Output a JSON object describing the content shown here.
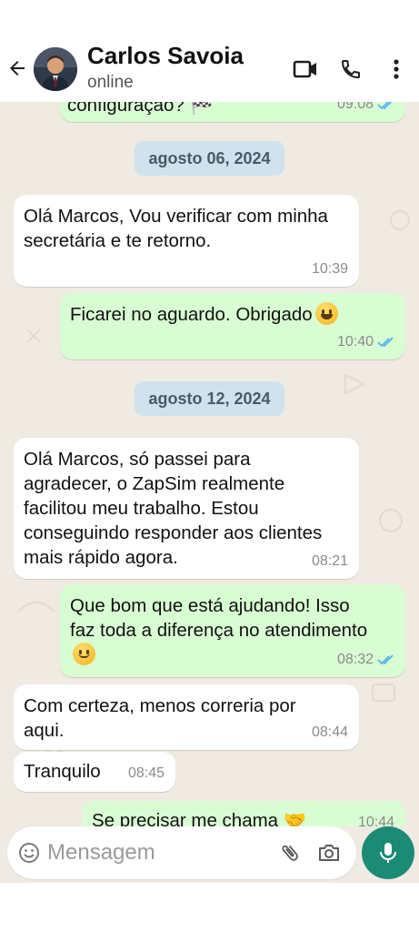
{
  "header": {
    "contact_name": "Carlos Savoia",
    "status": "online",
    "icons": [
      "back-arrow-icon",
      "video-call-icon",
      "phone-icon",
      "more-vert-icon"
    ]
  },
  "colors": {
    "incoming_bubble": "#ffffff",
    "outgoing_bubble": "#d9fdd3",
    "chat_background": "#efeae2",
    "date_pill": "#cfe2ee",
    "read_ticks": "#4fb6ec",
    "mic_button": "#1c8b75"
  },
  "messages": {
    "m0": {
      "text": "configuração? 🏁",
      "time": "09:08",
      "direction": "outgoing",
      "read": true
    },
    "date1": "agosto 06, 2024",
    "m1": {
      "text": "Olá Marcos, Vou verificar com minha secretária e te retorno.",
      "time": "10:39",
      "direction": "incoming"
    },
    "m2": {
      "text": "Ficarei no aguardo. Obrigado",
      "time": "10:40",
      "direction": "outgoing",
      "read": true,
      "emoji": "grinning-face"
    },
    "date2": "agosto 12, 2024",
    "m3": {
      "text": "Olá Marcos, só passei para agradecer, o ZapSim realmente facilitou meu trabalho. Estou conseguindo responder aos clientes mais rápido agora.",
      "time": "08:21",
      "direction": "incoming"
    },
    "m4": {
      "text": "Que bom que está ajudando! Isso faz toda a diferença no atendimento",
      "time": "08:32",
      "direction": "outgoing",
      "read": true,
      "emoji": "slightly-smiling-face"
    },
    "m5": {
      "text": "Com certeza, menos correria por aqui.",
      "time": "08:44",
      "direction": "incoming"
    },
    "m6": {
      "text": "Tranquilo",
      "time": "08:45",
      "direction": "incoming"
    },
    "m7": {
      "text": "Se precisar me chama 🤝",
      "time": "10:44",
      "direction": "outgoing",
      "read": true
    }
  },
  "composer": {
    "placeholder": "Mensagem",
    "icons": [
      "emoji-icon",
      "attach-icon",
      "camera-icon",
      "mic-icon"
    ]
  }
}
